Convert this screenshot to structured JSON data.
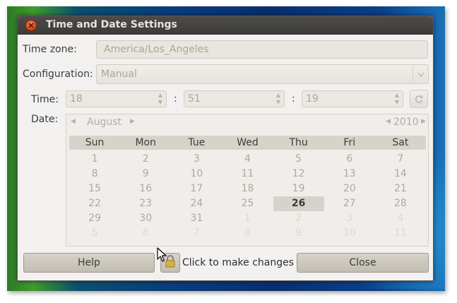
{
  "window": {
    "title": "Time and Date Settings"
  },
  "timezone": {
    "label": "Time zone:",
    "value": "America/Los_Angeles"
  },
  "configuration": {
    "label": "Configuration:",
    "value": "Manual"
  },
  "time": {
    "label": "Time:",
    "hours": "18",
    "minutes": "51",
    "seconds": "19",
    "separator": ":"
  },
  "date": {
    "label": "Date:",
    "month": "August",
    "year": "2010",
    "weekdays": [
      "Sun",
      "Mon",
      "Tue",
      "Wed",
      "Thu",
      "Fri",
      "Sat"
    ],
    "weeks": [
      [
        "1",
        "2",
        "3",
        "4",
        "5",
        "6",
        "7"
      ],
      [
        "8",
        "9",
        "10",
        "11",
        "12",
        "13",
        "14"
      ],
      [
        "15",
        "16",
        "17",
        "18",
        "19",
        "20",
        "21"
      ],
      [
        "22",
        "23",
        "24",
        "25",
        "26",
        "27",
        "28"
      ],
      [
        "29",
        "30",
        "31",
        "1",
        "2",
        "3",
        "4"
      ],
      [
        "5",
        "6",
        "7",
        "8",
        "9",
        "10",
        "11"
      ]
    ],
    "selected_day": "26"
  },
  "buttons": {
    "help": "Help",
    "unlock_label": "Click to make changes",
    "close": "Close"
  },
  "icons": {
    "close": "close-icon",
    "dropdown": "chevron-down-icon",
    "refresh": "refresh-icon",
    "lock": "lock-icon",
    "cursor": "mouse-pointer-icon"
  }
}
